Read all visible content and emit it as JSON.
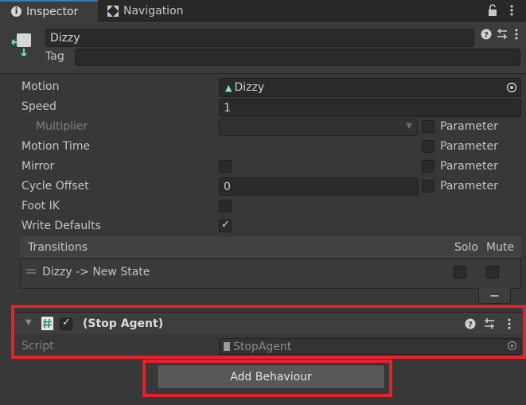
{
  "tabs": {
    "inspector": "Inspector",
    "navigation": "Navigation"
  },
  "header": {
    "name": "Dizzy",
    "tag_label": "Tag",
    "tag_value": ""
  },
  "fields": {
    "motion_label": "Motion",
    "motion_value": "Dizzy",
    "speed_label": "Speed",
    "speed_value": "1",
    "multiplier_label": "Multiplier",
    "motion_time_label": "Motion Time",
    "mirror_label": "Mirror",
    "cycle_offset_label": "Cycle Offset",
    "cycle_offset_value": "0",
    "foot_ik_label": "Foot IK",
    "write_defaults_label": "Write Defaults",
    "parameter_label": "Parameter"
  },
  "transitions": {
    "title": "Transitions",
    "solo_header": "Solo",
    "mute_header": "Mute",
    "rows": [
      {
        "label": "Dizzy -> New State"
      }
    ],
    "remove_label": "−"
  },
  "behaviour": {
    "title": "(Stop Agent)",
    "script_label": "Script",
    "script_value": "StopAgent",
    "add_button": "Add Behaviour"
  },
  "colors": {
    "highlight": "#e3232b",
    "accent": "#3a79bb",
    "motion_icon": "#7fe3c7"
  }
}
